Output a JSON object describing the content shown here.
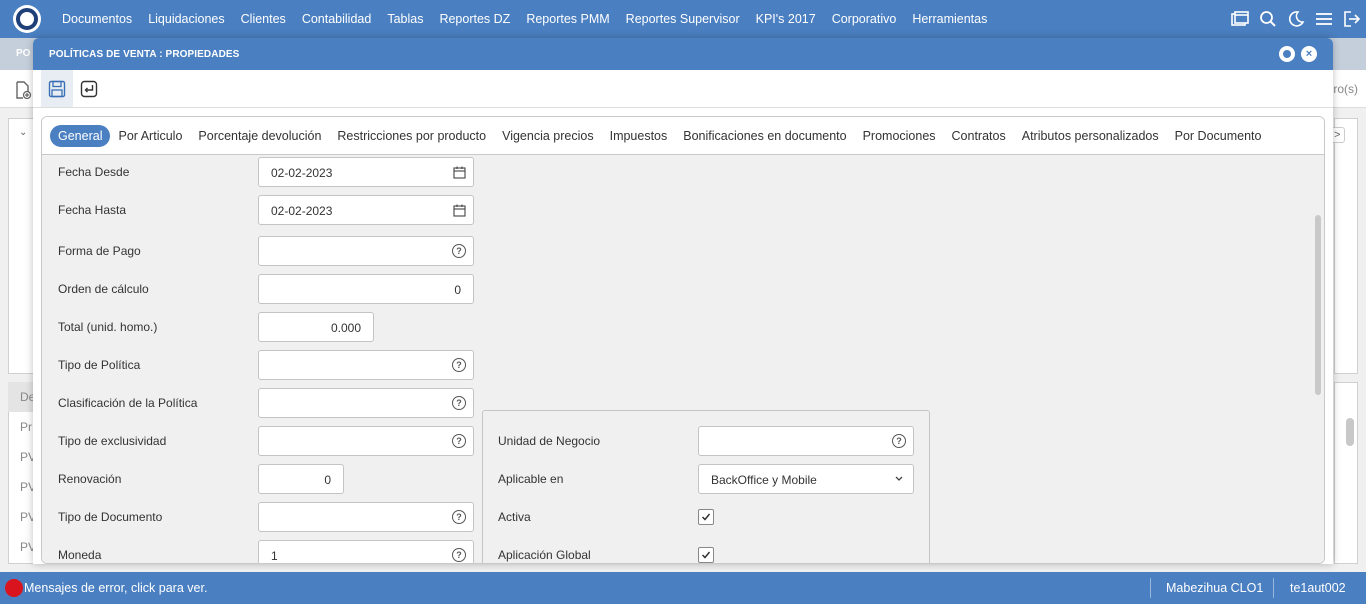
{
  "nav": {
    "items": [
      "Documentos",
      "Liquidaciones",
      "Clientes",
      "Contabilidad",
      "Tablas",
      "Reportes DZ",
      "Reportes PMM",
      "Reportes Supervisor",
      "KPI's 2017",
      "Corporativo",
      "Herramientas"
    ]
  },
  "background": {
    "subbar_text": "PO",
    "right_text": "ro(s)",
    "rows": [
      "De",
      "Pr",
      "PV",
      "PV",
      "PV",
      "PV"
    ]
  },
  "modal": {
    "title": "POLÍTICAS DE VENTA : PROPIEDADES",
    "tabs": [
      "General",
      "Por Articulo",
      "Porcentaje devolución",
      "Restricciones por producto",
      "Vigencia precios",
      "Impuestos",
      "Bonificaciones en documento",
      "Promociones",
      "Contratos",
      "Atributos personalizados",
      "Por Documento"
    ]
  },
  "form": {
    "fecha_desde": {
      "label": "Fecha Desde",
      "value": "02-02-2023"
    },
    "fecha_hasta": {
      "label": "Fecha Hasta",
      "value": "02-02-2023"
    },
    "forma_pago": {
      "label": "Forma de Pago",
      "value": ""
    },
    "orden_calculo": {
      "label": "Orden de cálculo",
      "value": "0"
    },
    "total_homo": {
      "label": "Total (unid. homo.)",
      "value": "0.000"
    },
    "tipo_politica": {
      "label": "Tipo de Política",
      "value": ""
    },
    "clasificacion": {
      "label": "Clasificación de la Política",
      "value": ""
    },
    "tipo_exclusividad": {
      "label": "Tipo de exclusividad",
      "value": ""
    },
    "renovacion": {
      "label": "Renovación",
      "value": "0"
    },
    "tipo_documento": {
      "label": "Tipo de Documento",
      "value": ""
    },
    "moneda": {
      "label": "Moneda",
      "value": "1"
    },
    "unidad_negocio": {
      "label": "Unidad de Negocio",
      "value": ""
    },
    "aplicable_en": {
      "label": "Aplicable en",
      "value": "BackOffice y Mobile"
    },
    "activa": {
      "label": "Activa",
      "checked": true
    },
    "aplicacion_global": {
      "label": "Aplicación Global",
      "checked": true
    }
  },
  "status": {
    "error_text": "Mensajes de error, click para ver.",
    "user": "Mabezihua CLO1",
    "host": "te1aut002"
  },
  "colors": {
    "primary": "#4a7fc1",
    "error": "#d9141e"
  }
}
